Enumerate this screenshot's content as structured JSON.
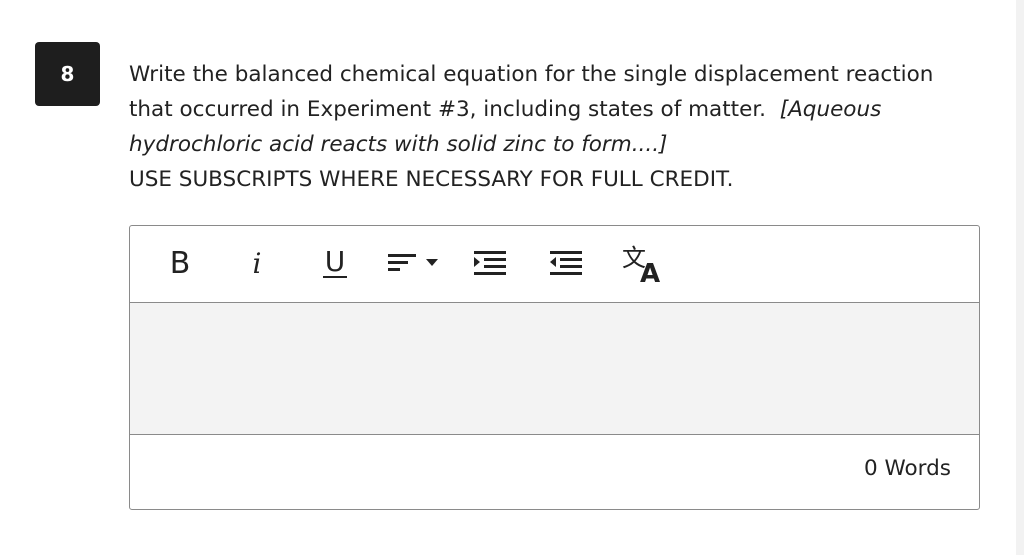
{
  "question": {
    "number": "8",
    "line1": "Write the balanced chemical equation for the single displacement reaction",
    "line2_prefix": "that occurred in Experiment #3, including states of matter.",
    "hint": "[Aqueous hydrochloric acid reacts with solid zinc to form....]",
    "note": "USE SUBSCRIPTS WHERE NECESSARY FOR FULL CREDIT."
  },
  "editor": {
    "toolbar": {
      "bold_label": "B",
      "italic_label": "i",
      "underline_label": "U",
      "align_icon": "align-dropdown-icon",
      "indent_icon": "indent-icon",
      "outdent_icon": "outdent-icon",
      "translate_icon": "translate-icon"
    },
    "value": "",
    "word_count": "0 Words"
  }
}
